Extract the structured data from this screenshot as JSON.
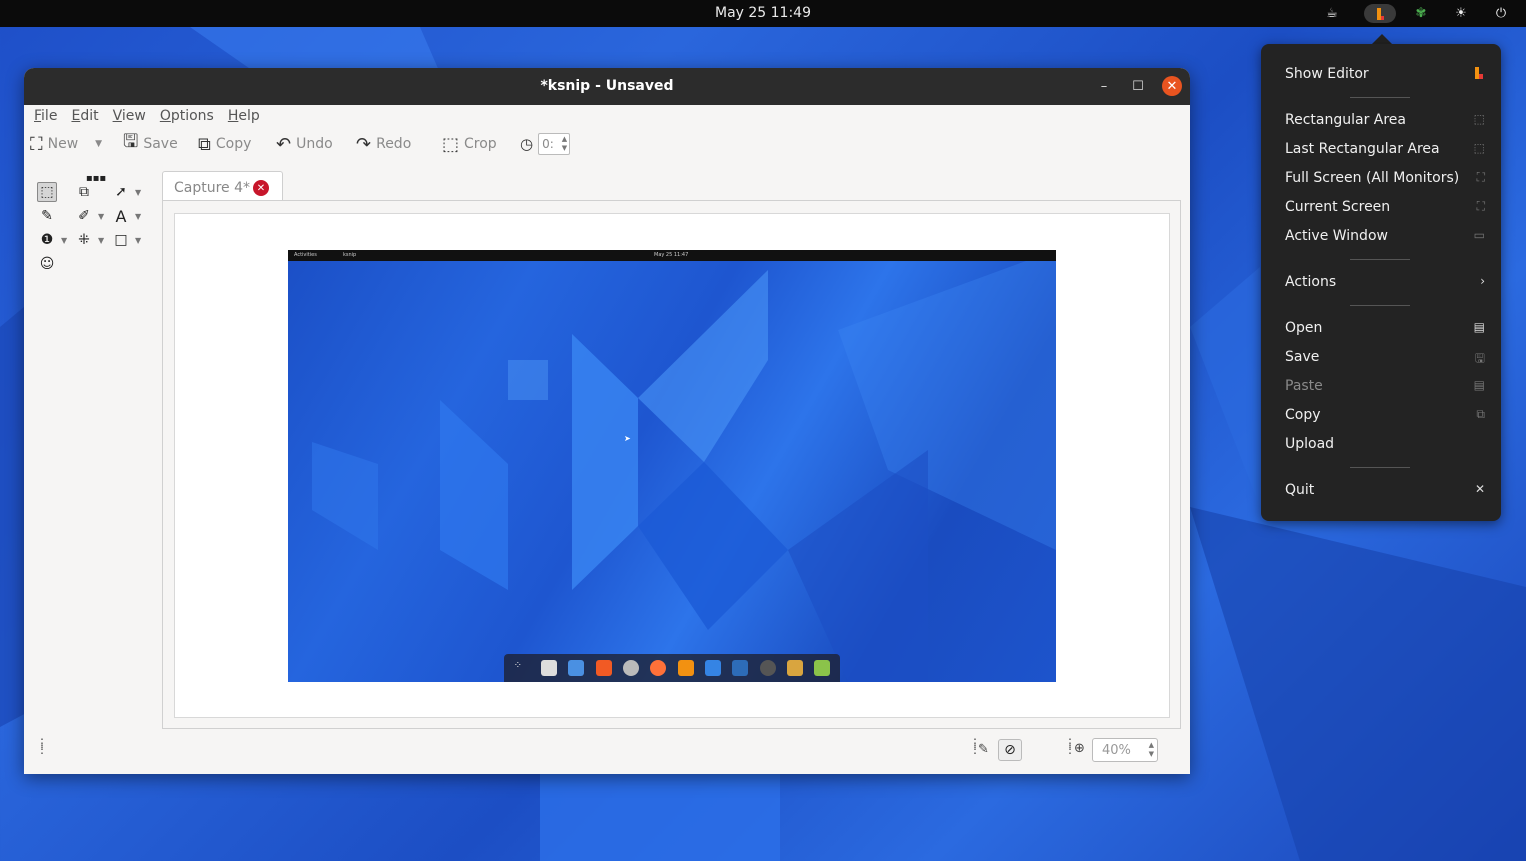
{
  "topbar": {
    "clock": "May 25  11:49"
  },
  "window": {
    "title": "*ksnip - Unsaved",
    "menu": [
      "File",
      "Edit",
      "View",
      "Options",
      "Help"
    ],
    "toolbar": {
      "new_label": "New",
      "save_label": "Save",
      "copy_label": "Copy",
      "undo_label": "Undo",
      "redo_label": "Redo",
      "crop_label": "Crop",
      "delay_value": "0:"
    },
    "tab": {
      "label": "Capture 4*"
    },
    "screenshot_topbar": {
      "left": "Activities",
      "app": "ksnip",
      "clock": "May 25  11:47"
    },
    "zoom_value": "40%"
  },
  "tray_menu": {
    "items": [
      {
        "label": "Show Editor"
      },
      {
        "label": "Rectangular Area"
      },
      {
        "label": "Last Rectangular Area"
      },
      {
        "label": "Full Screen (All Monitors)"
      },
      {
        "label": "Current Screen"
      },
      {
        "label": "Active Window"
      },
      {
        "label": "Actions"
      },
      {
        "label": "Open"
      },
      {
        "label": "Save"
      },
      {
        "label": "Paste",
        "disabled": true
      },
      {
        "label": "Copy"
      },
      {
        "label": "Upload"
      },
      {
        "label": "Quit"
      }
    ]
  },
  "colors": {
    "accent": "#e95420",
    "tab_close": "#c7162b",
    "desktop": "#1e56d0"
  }
}
